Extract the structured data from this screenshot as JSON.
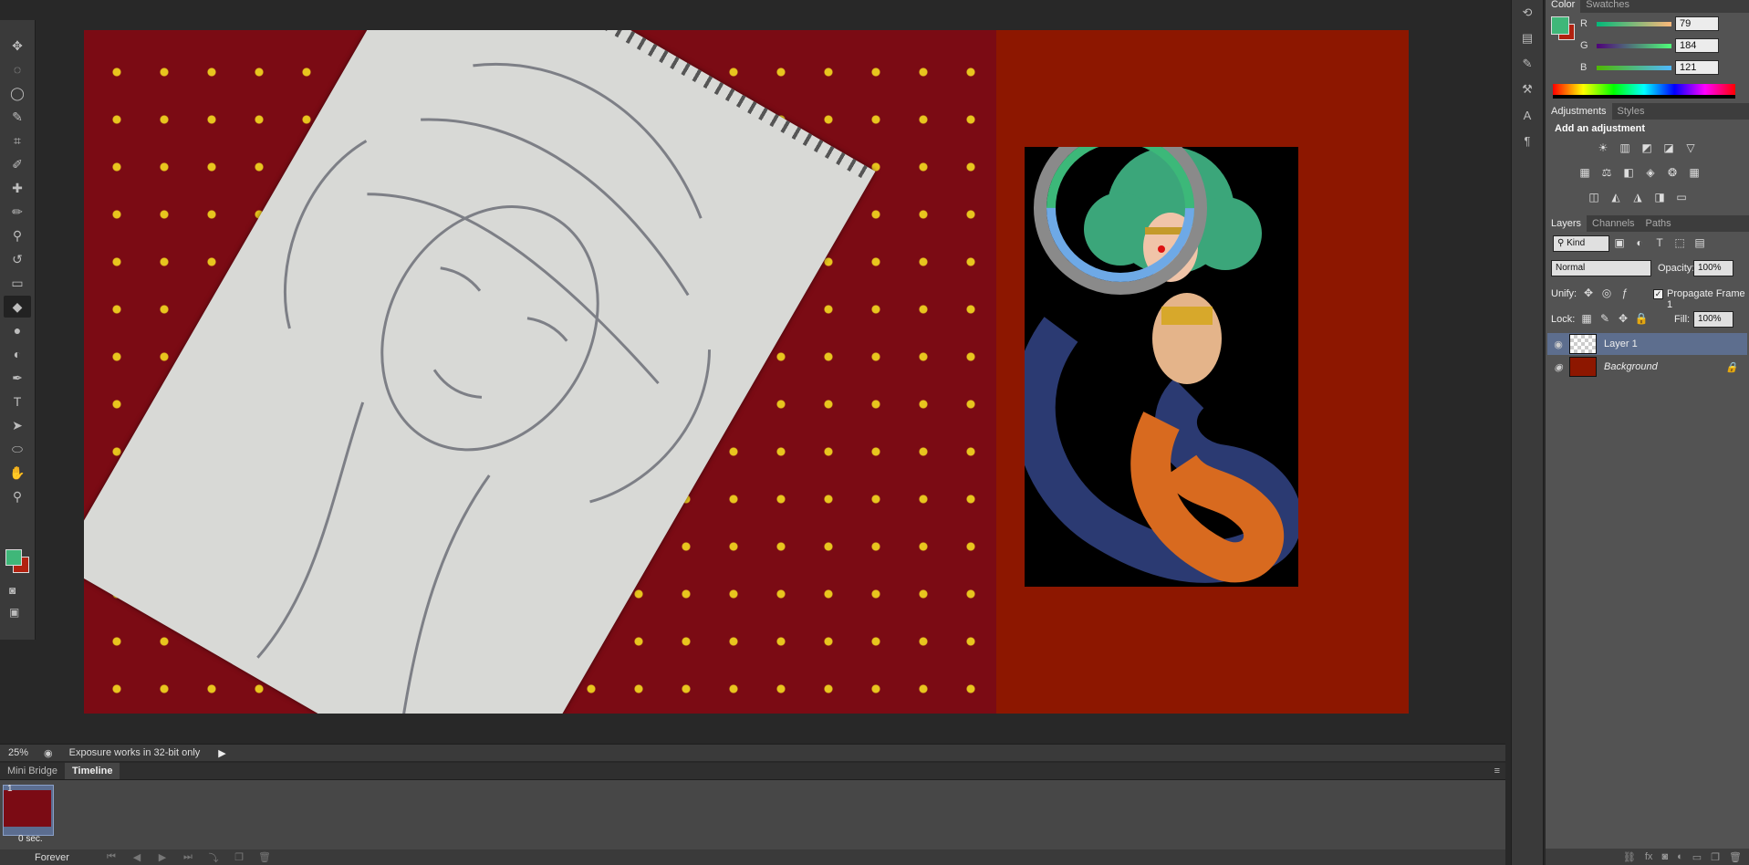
{
  "status_bar": {
    "zoom": "25%",
    "doc_info": "Exposure works in 32-bit only"
  },
  "bottom_panel": {
    "tabs": [
      "Mini Bridge",
      "Timeline"
    ],
    "frame": {
      "number": "1",
      "delay": "0 sec."
    },
    "loop": "Forever"
  },
  "color_panel": {
    "tabs": [
      "Color",
      "Swatches"
    ],
    "foreground": "#3fb779",
    "background": "#b1210f",
    "channels": [
      {
        "label": "R",
        "value": "79"
      },
      {
        "label": "G",
        "value": "184"
      },
      {
        "label": "B",
        "value": "121"
      }
    ]
  },
  "adjustments_panel": {
    "tabs": [
      "Adjustments",
      "Styles"
    ],
    "heading": "Add an adjustment"
  },
  "layers_panel": {
    "tabs": [
      "Layers",
      "Channels",
      "Paths"
    ],
    "filter": "Kind",
    "blend_mode": "Normal",
    "opacity_label": "Opacity:",
    "opacity": "100%",
    "unify_label": "Unify:",
    "propagate_label": "Propagate Frame 1",
    "lock_label": "Lock:",
    "fill_label": "Fill:",
    "fill": "100%",
    "layers": [
      {
        "name": "Layer 1"
      },
      {
        "name": "Background"
      }
    ]
  },
  "canvas": {
    "background_color": "#8d1700"
  }
}
